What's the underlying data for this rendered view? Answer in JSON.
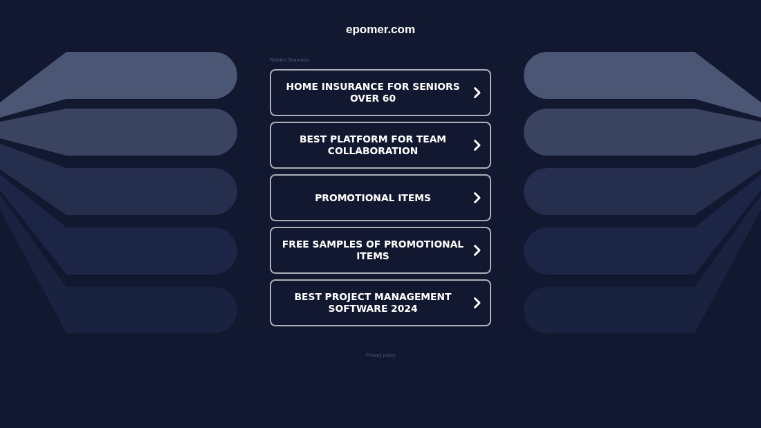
{
  "header": {
    "title": "epomer.com"
  },
  "related": {
    "heading": "Related Searches:",
    "links": [
      {
        "label": "HOME INSURANCE FOR SENIORS OVER 60"
      },
      {
        "label": "BEST PLATFORM FOR TEAM COLLABORATION"
      },
      {
        "label": "PROMOTIONAL ITEMS"
      },
      {
        "label": "FREE SAMPLES OF PROMOTIONAL ITEMS"
      },
      {
        "label": "BEST PROJECT MANAGEMENT SOFTWARE 2024"
      }
    ]
  },
  "footer": {
    "privacy_link": "Privacy policy"
  }
}
